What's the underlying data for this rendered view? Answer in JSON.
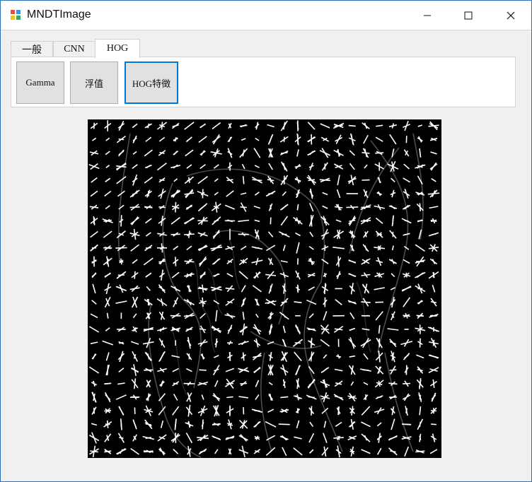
{
  "window": {
    "title": "MNDTImage",
    "icons": {
      "app": "app-icon",
      "minimize": "minimize-icon",
      "maximize": "maximize-icon",
      "close": "close-icon"
    }
  },
  "tabs": [
    {
      "label": "一般",
      "active": false
    },
    {
      "label": "CNN",
      "active": false
    },
    {
      "label": "HOG",
      "active": true
    }
  ],
  "toolbar": {
    "buttons": [
      {
        "label": "Gamma",
        "focused": false
      },
      {
        "label": "浮值",
        "focused": false
      },
      {
        "label": "HOG特徵",
        "focused": true
      }
    ]
  },
  "image": {
    "description_name": "hog-feature-visualization"
  },
  "colors": {
    "accent": "#0078d7",
    "background": "#f0f0f0"
  }
}
